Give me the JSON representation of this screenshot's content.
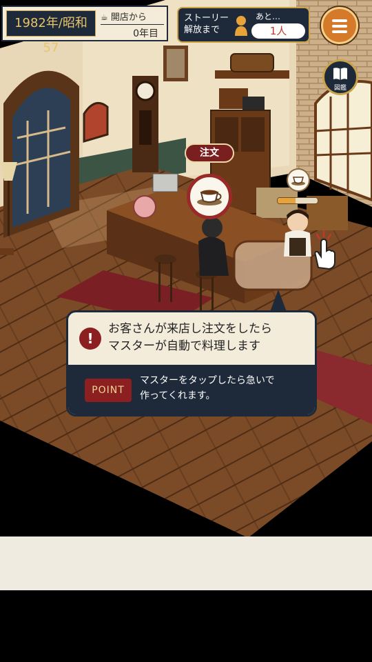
{
  "hud": {
    "date": "1982年/昭和57",
    "open_label": "開店から",
    "open_value": "0年目",
    "story_line1": "ストーリー",
    "story_line2": "解放まで",
    "story_after": "あと…",
    "story_count": "1人",
    "book_label": "図鑑"
  },
  "order": {
    "label": "注文",
    "item_icon": "coffee-cup-icon",
    "progress": 0.45
  },
  "tutorial": {
    "line1": "お客さんが来店し注文をしたら",
    "line2": "マスターが自動で料理します",
    "point_label": "POINT",
    "point_line1": "マスターをタップしたら急いで",
    "point_line2": "作ってくれます。"
  },
  "icons": {
    "menu": "hamburger-icon",
    "book": "book-icon",
    "hand": "tap-hand-icon",
    "alert": "exclamation-icon"
  },
  "colors": {
    "navy": "#1e2a3a",
    "gold": "#c9a24a",
    "accent_red": "#8c1f1f",
    "orange": "#d47a2a"
  }
}
